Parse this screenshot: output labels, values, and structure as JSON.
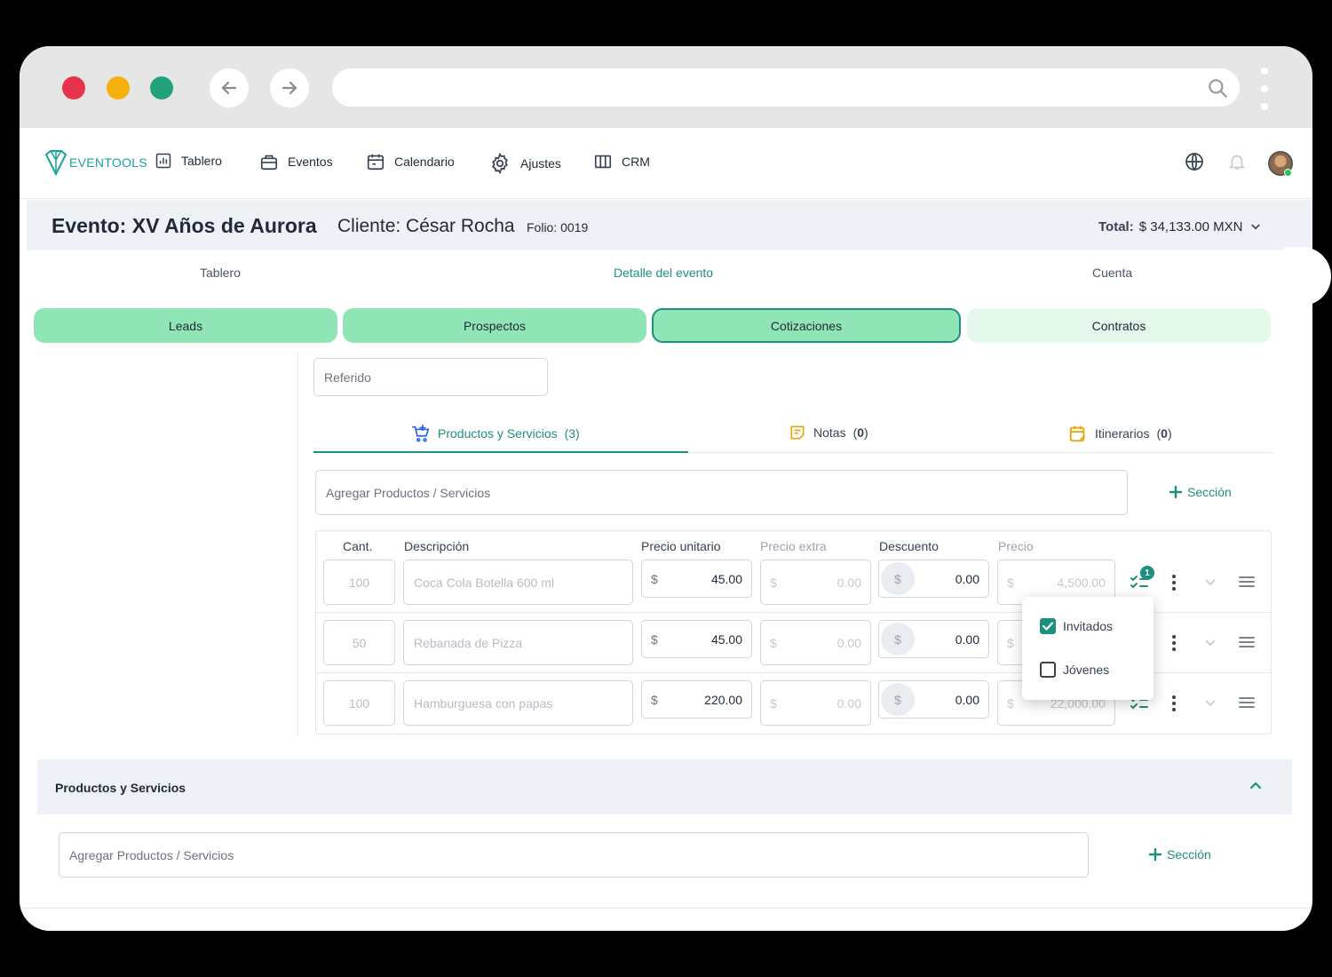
{
  "nav": {
    "logo": "EVENTOOLS",
    "items": [
      {
        "label": "Tablero",
        "icon": "chart-icon"
      },
      {
        "label": "Eventos",
        "icon": "briefcase-icon"
      },
      {
        "label": "Calendario",
        "icon": "calendar-icon"
      },
      {
        "label": "Ajustes",
        "icon": "gear-icon"
      },
      {
        "label": "CRM",
        "icon": "columns-icon"
      }
    ]
  },
  "event": {
    "title": "Evento: XV Años de Aurora",
    "client": "Cliente: César Rocha",
    "folio": "Folio: 0019",
    "total_label": "Total:",
    "total_value": "$ 34,133.00 MXN"
  },
  "subtabs": [
    "Tablero",
    "Detalle del evento",
    "Cuenta"
  ],
  "pipeline": [
    "Leads",
    "Prospectos",
    "Cotizaciones",
    "Contratos"
  ],
  "referido_value": "Referido",
  "product_tabs": [
    {
      "label": "Productos y Servicios",
      "count": "(3)"
    },
    {
      "label": "Notas",
      "count": "0"
    },
    {
      "label": "Itinerarios",
      "count": "0"
    }
  ],
  "add_products_placeholder": "Agregar Productos / Servicios",
  "seccion_label": "Sección",
  "table": {
    "headers": [
      "Cant.",
      "Descripción",
      "Precio unitario",
      "Precio extra",
      "Descuento",
      "Precio"
    ],
    "currency": "$",
    "rows": [
      {
        "qty": "100",
        "desc": "Coca Cola Botella 600 ml",
        "unit": "45.00",
        "extra": "0.00",
        "discount": "0.00",
        "price": "4,500.00"
      },
      {
        "qty": "50",
        "desc": "Rebanada de Pizza",
        "unit": "45.00",
        "extra": "0.00",
        "discount": "0.00",
        "price": ""
      },
      {
        "qty": "100",
        "desc": "Hamburguesa con papas",
        "unit": "220.00",
        "extra": "0.00",
        "discount": "0.00",
        "price": "22,000.00"
      }
    ],
    "badge_count": "1"
  },
  "guest_dropdown": [
    {
      "label": "Invitados",
      "checked": true
    },
    {
      "label": "Jóvenes",
      "checked": false
    }
  ],
  "accordion": {
    "title": "Productos y Servicios"
  },
  "colors": {
    "accent": "#1d8f7f",
    "pill": "#8fe5b6",
    "pill_light": "#e4f8ec"
  }
}
